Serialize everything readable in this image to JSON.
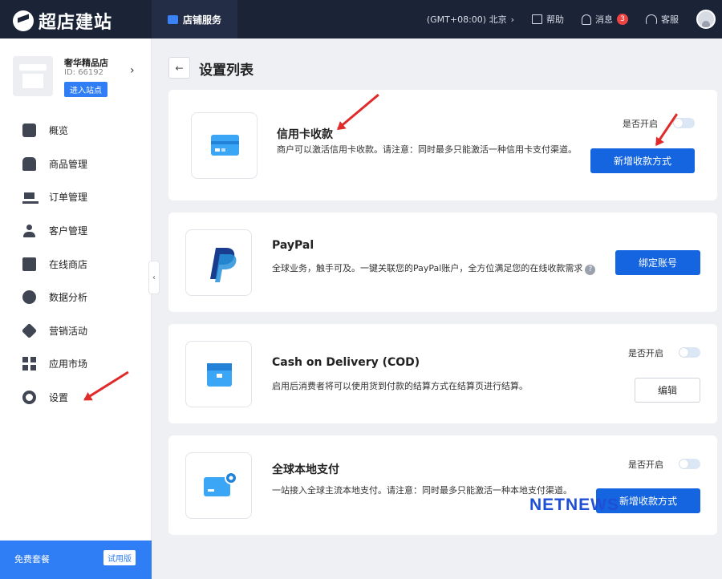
{
  "header": {
    "brand": "超店建站",
    "tab": "店铺服务",
    "timezone": "(GMT+08:00) 北京",
    "help": "帮助",
    "messages": "消息",
    "message_count": "3",
    "support": "客服"
  },
  "store": {
    "name": "奢华精品店",
    "id": "ID: 66192",
    "enter": "进入站点"
  },
  "nav": [
    {
      "label": "概览",
      "icon": "dashboard-icon"
    },
    {
      "label": "商品管理",
      "icon": "bag-icon"
    },
    {
      "label": "订单管理",
      "icon": "cart-icon"
    },
    {
      "label": "客户管理",
      "icon": "user-icon"
    },
    {
      "label": "在线商店",
      "icon": "shop-icon"
    },
    {
      "label": "数据分析",
      "icon": "pie-chart-icon"
    },
    {
      "label": "营销活动",
      "icon": "tag-icon"
    },
    {
      "label": "应用市场",
      "icon": "grid-icon"
    },
    {
      "label": "设置",
      "icon": "gear-icon"
    }
  ],
  "plan": {
    "label": "免费套餐",
    "tag": "试用版"
  },
  "page": {
    "title": "设置列表"
  },
  "cards": [
    {
      "title": "信用卡收款",
      "desc": "商户可以激活信用卡收款。请注意：同时最多只能激活一种信用卡支付渠道。",
      "toggle_label": "是否开启",
      "toggle_on": false,
      "button": "新增收款方式",
      "icon": "credit-card-icon"
    },
    {
      "title": "PayPal",
      "desc": "全球业务，触手可及。一键关联您的PayPal账户，全方位满足您的在线收款需求",
      "button": "绑定账号",
      "icon": "paypal-icon"
    },
    {
      "title": "Cash on Delivery (COD)",
      "desc": "启用后消费者将可以使用货到付款的结算方式在结算页进行结算。",
      "toggle_label": "是否开启",
      "toggle_on": false,
      "button": "编辑",
      "icon": "package-icon"
    },
    {
      "title": "全球本地支付",
      "desc": "一站接入全球主流本地支付。请注意：同时最多只能激活一种本地支付渠道。",
      "toggle_label": "是否开启",
      "toggle_on": false,
      "button": "新增收款方式",
      "icon": "location-card-icon"
    }
  ],
  "watermark": "NETNEWS",
  "colors": {
    "primary": "#1565e0",
    "header_bg": "#1b2336",
    "annotation": "#e02b2b"
  }
}
